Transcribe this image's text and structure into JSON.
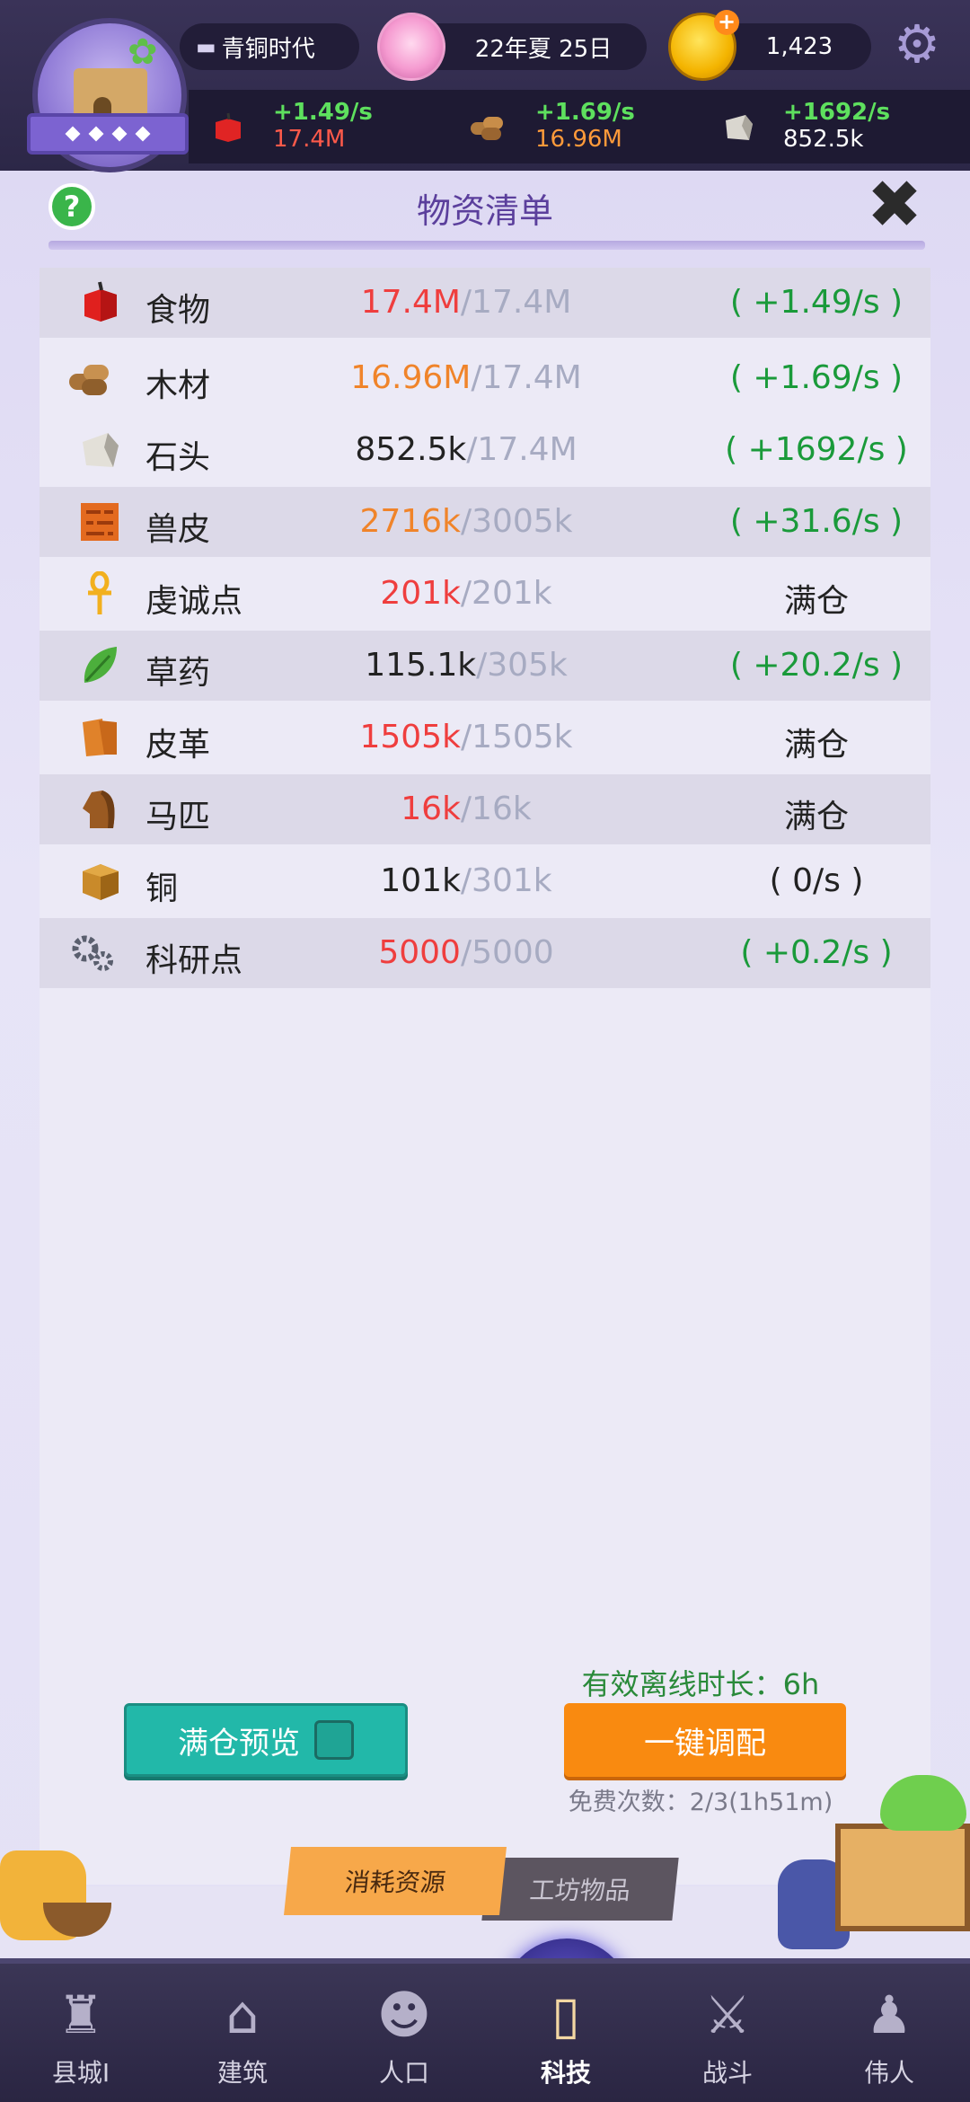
{
  "header": {
    "era": "青铜时代",
    "date": "22年夏 25日",
    "coins": "1,423",
    "resources": [
      {
        "icon": "food-icon",
        "rate": "+1.49/s",
        "amount": "17.4M",
        "amount_color": "#ff5a4a"
      },
      {
        "icon": "wood-icon",
        "rate": "+1.69/s",
        "amount": "16.96M",
        "amount_color": "#ff9a3a"
      },
      {
        "icon": "stone-icon",
        "rate": "+1692/s",
        "amount": "852.5k",
        "amount_color": "#ffffff"
      }
    ]
  },
  "panel": {
    "title": "物资清单",
    "help_label": "?",
    "rows": [
      {
        "icon": "food-icon",
        "name": "食物",
        "current": "17.4M",
        "cap": "/17.4M",
        "current_color": "red",
        "rate": "( +1.49/s )"
      },
      {
        "icon": "wood-icon",
        "name": "木材",
        "current": "16.96M",
        "cap": "/17.4M",
        "current_color": "orange",
        "rate": "( +1.69/s )"
      },
      {
        "icon": "stone-icon",
        "name": "石头",
        "current": "852.5k",
        "cap": "/17.4M",
        "current_color": "black",
        "rate": "( +1692/s )"
      },
      {
        "icon": "hide-icon",
        "name": "兽皮",
        "current": "2716k",
        "cap": "/3005k",
        "current_color": "orange",
        "rate": "( +31.6/s )"
      },
      {
        "icon": "ankh-icon",
        "name": "虔诚点",
        "current": "201k",
        "cap": "/201k",
        "current_color": "red",
        "rate": "满仓"
      },
      {
        "icon": "herb-icon",
        "name": "草药",
        "current": "115.1k",
        "cap": "/305k",
        "current_color": "black",
        "rate": "( +20.2/s )"
      },
      {
        "icon": "leather-icon",
        "name": "皮革",
        "current": "1505k",
        "cap": "/1505k",
        "current_color": "red",
        "rate": "满仓"
      },
      {
        "icon": "horse-icon",
        "name": "马匹",
        "current": "16k",
        "cap": "/16k",
        "current_color": "red",
        "rate": "满仓"
      },
      {
        "icon": "copper-icon",
        "name": "铜",
        "current": "101k",
        "cap": "/301k",
        "current_color": "black",
        "rate": "( 0/s )"
      },
      {
        "icon": "gears-icon",
        "name": "科研点",
        "current": "5000",
        "cap": "/5000",
        "current_color": "red",
        "rate": "( +0.2/s )"
      }
    ],
    "offline_label": "有效离线时长：6h",
    "preview_button": "满仓预览",
    "allot_button": "一键调配",
    "free_count": "免费次数：2/3(1h51m)",
    "tabs": [
      "消耗资源",
      "工坊物品"
    ]
  },
  "nav": [
    {
      "icon": "castle-icon",
      "label": "县城I"
    },
    {
      "icon": "house-icon",
      "label": "建筑"
    },
    {
      "icon": "people-icon",
      "label": "人口"
    },
    {
      "icon": "book-icon",
      "label": "科技"
    },
    {
      "icon": "swords-icon",
      "label": "战斗"
    },
    {
      "icon": "statue-icon",
      "label": "伟人"
    }
  ],
  "nav_active": "科技",
  "colors": {
    "accent_green": "#1a9a3a",
    "full_red": "#ef3e3e",
    "teal_button": "#22b8a9",
    "orange_button": "#f98a10"
  }
}
